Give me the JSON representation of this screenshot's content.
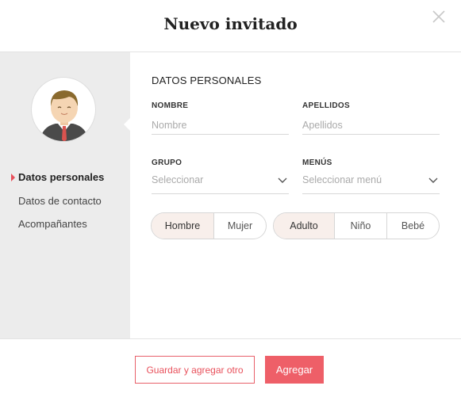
{
  "dialog": {
    "title": "Nuevo invitado"
  },
  "icons": {
    "close": "close-icon",
    "avatar": "male-guest-avatar-icon",
    "chevron": "chevron-down-icon"
  },
  "colors": {
    "accent": "#e8505b",
    "sidebar_bg": "#ececec",
    "selected_bg": "#f8efeb"
  },
  "sidebar": {
    "items": [
      {
        "label": "Datos personales",
        "active": true
      },
      {
        "label": "Datos de contacto",
        "active": false
      },
      {
        "label": "Acompañantes",
        "active": false
      }
    ]
  },
  "form": {
    "section_title": "DATOS PERSONALES",
    "nombre": {
      "label": "NOMBRE",
      "placeholder": "Nombre",
      "value": ""
    },
    "apellidos": {
      "label": "APELLIDOS",
      "placeholder": "Apellidos",
      "value": ""
    },
    "grupo": {
      "label": "GRUPO",
      "value": "Seleccionar"
    },
    "menus": {
      "label": "MENÚS",
      "value": "Seleccionar menú"
    },
    "gender": {
      "options": [
        "Hombre",
        "Mujer"
      ],
      "selected": "Hombre"
    },
    "age": {
      "options": [
        "Adulto",
        "Niño",
        "Bebé"
      ],
      "selected": "Adulto"
    }
  },
  "footer": {
    "save_and_add_label": "Guardar y agregar otro",
    "add_label": "Agregar"
  }
}
